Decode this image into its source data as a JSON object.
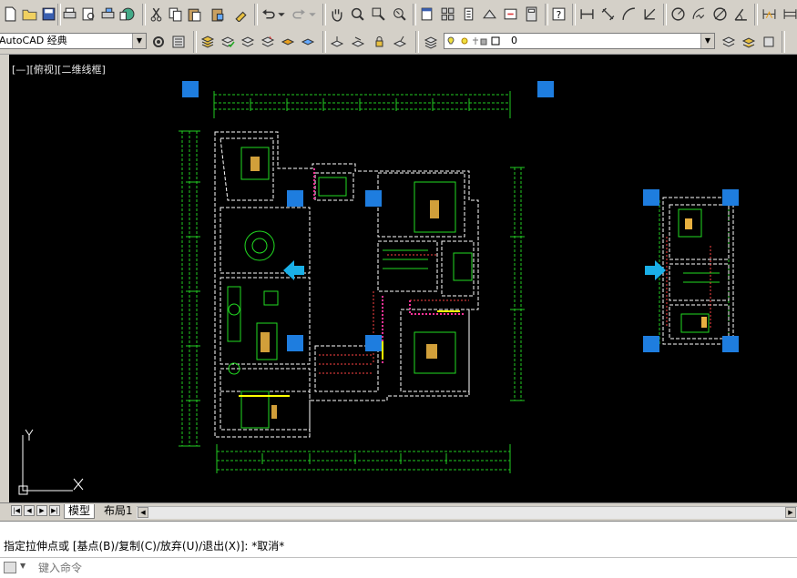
{
  "toolbar": {
    "workspace": "AutoCAD 经典",
    "layer_name": "0"
  },
  "viewport": {
    "label": "[—][俯视][二维线框]",
    "ucs_x": "X",
    "ucs_y": "Y"
  },
  "tabs": {
    "model": "模型",
    "layout1": "布局1"
  },
  "command": {
    "history_line": "指定拉伸点或 [基点(B)/复制(C)/放弃(U)/退出(X)]: *取消*",
    "placeholder": "键入命令"
  },
  "colors": {
    "canvas": "#000000",
    "grip": "#1e7ddf",
    "arrow": "#1ab0e8",
    "dims": "#22cc22",
    "walls": "#ffffff"
  }
}
